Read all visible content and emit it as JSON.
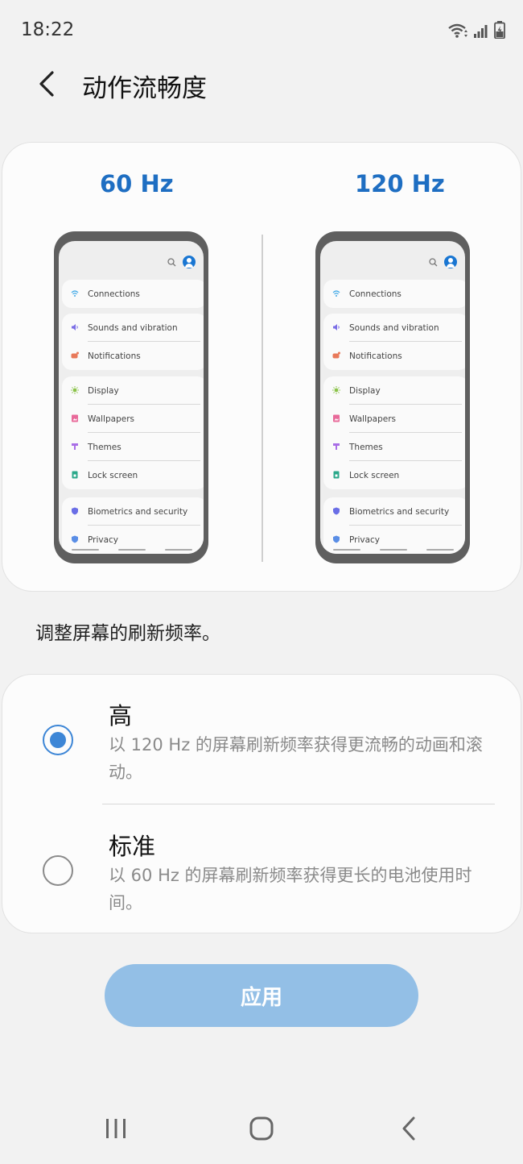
{
  "status_bar": {
    "time": "18:22",
    "icons": [
      "wifi-icon",
      "signal-icon",
      "battery-icon"
    ]
  },
  "header": {
    "title": "动作流畅度",
    "back_icon": "chevron-left-icon"
  },
  "preview": {
    "left_label": "60 Hz",
    "right_label": "120 Hz",
    "settings_items": {
      "connections": "Connections",
      "sounds": "Sounds and vibration",
      "notifications": "Notifications",
      "display": "Display",
      "wallpapers": "Wallpapers",
      "themes": "Themes",
      "lock_screen": "Lock screen",
      "biometrics": "Biometrics and security",
      "privacy": "Privacy"
    }
  },
  "description": "调整屏幕的刷新频率。",
  "options": [
    {
      "title": "高",
      "desc": "以 120 Hz 的屏幕刷新频率获得更流畅的动画和滚动。",
      "selected": true
    },
    {
      "title": "标准",
      "desc": "以 60 Hz 的屏幕刷新频率获得更长的电池使用时间。",
      "selected": false
    }
  ],
  "apply_label": "应用",
  "colors": {
    "accent": "#1e6ec2",
    "radio_selected": "#3d86d6",
    "apply_button": "#93bfe6"
  },
  "nav_bar": {
    "icons": [
      "recent-apps-icon",
      "home-icon",
      "back-icon"
    ]
  }
}
